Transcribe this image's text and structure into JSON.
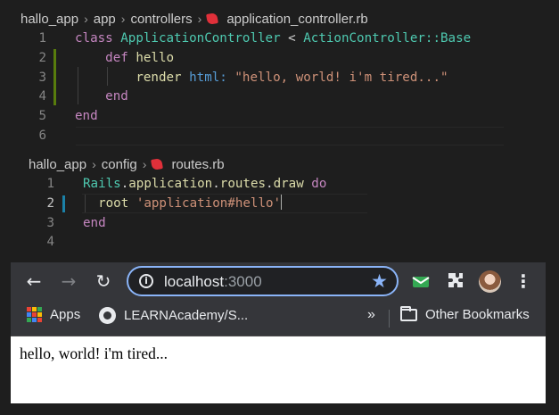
{
  "editor1": {
    "breadcrumb": [
      "hallo_app",
      "app",
      "controllers",
      "application_controller.rb"
    ],
    "lines": [
      {
        "n": "1",
        "tokens": [
          [
            "kw",
            "class "
          ],
          [
            "cls",
            "ApplicationController"
          ],
          [
            "plain",
            " < "
          ],
          [
            "cls",
            "ActionController::Base"
          ]
        ]
      },
      {
        "n": "2",
        "tokens": [
          [
            "plain",
            "    "
          ],
          [
            "kw",
            "def "
          ],
          [
            "fn",
            "hello"
          ]
        ]
      },
      {
        "n": "3",
        "tokens": [
          [
            "plain",
            "        "
          ],
          [
            "fn",
            "render "
          ],
          [
            "kwb",
            "html: "
          ],
          [
            "str",
            "\"hello, world! i'm tired...\""
          ]
        ]
      },
      {
        "n": "4",
        "tokens": [
          [
            "plain",
            "    "
          ],
          [
            "kw",
            "end"
          ]
        ]
      },
      {
        "n": "5",
        "tokens": [
          [
            "kw",
            "end"
          ]
        ]
      },
      {
        "n": "6",
        "tokens": []
      }
    ]
  },
  "editor2": {
    "breadcrumb": [
      "hallo_app",
      "config",
      "routes.rb"
    ],
    "lines": [
      {
        "n": "1",
        "tokens": [
          [
            "cls",
            "Rails"
          ],
          [
            "plain",
            "."
          ],
          [
            "fn",
            "application"
          ],
          [
            "plain",
            "."
          ],
          [
            "fn",
            "routes"
          ],
          [
            "plain",
            "."
          ],
          [
            "fn",
            "draw "
          ],
          [
            "kw",
            "do"
          ]
        ]
      },
      {
        "n": "2",
        "tokens": [
          [
            "plain",
            "  "
          ],
          [
            "fn",
            "root "
          ],
          [
            "str",
            "'application#hello'"
          ]
        ]
      },
      {
        "n": "3",
        "tokens": [
          [
            "kw",
            "end"
          ]
        ]
      },
      {
        "n": "4",
        "tokens": []
      }
    ]
  },
  "browser": {
    "url_host": "localhost",
    "url_port": ":3000",
    "bookmarks": {
      "apps": "Apps",
      "github": "LEARNAcademy/S...",
      "overflow": "»",
      "other": "Other Bookmarks"
    },
    "page_text": "hello, world! i'm tired..."
  },
  "colors": {
    "editor_bg": "#1e1e1e",
    "browser_toolbar": "#35363a",
    "omnibox_focus": "#8ab4f8",
    "ruby_icon": "#e0303a"
  }
}
